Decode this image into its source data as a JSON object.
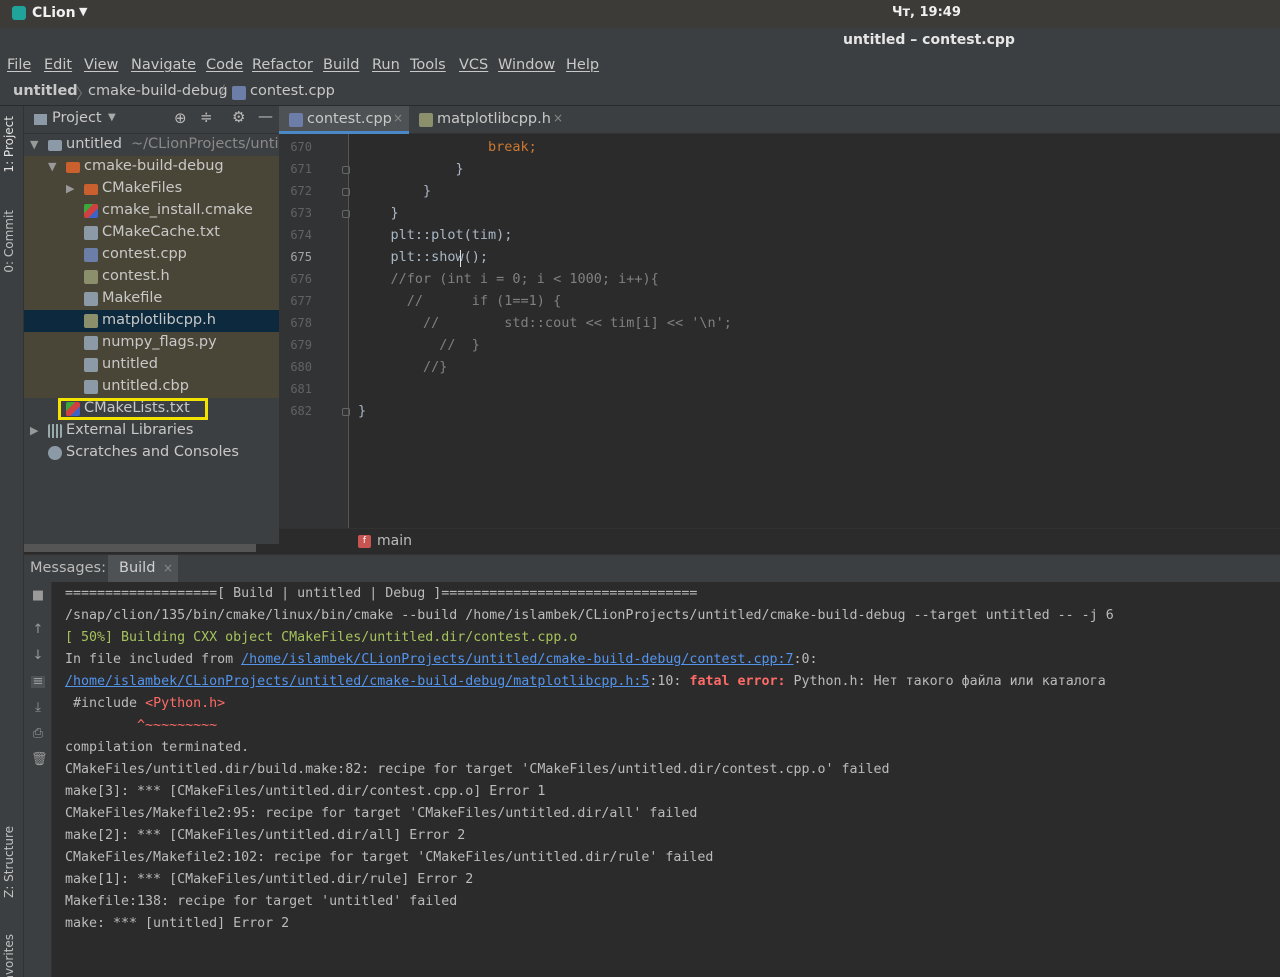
{
  "system": {
    "app_name": "CLion",
    "clock": "Чт, 19:49"
  },
  "window": {
    "title": "untitled – contest.cpp"
  },
  "menu": [
    "File",
    "Edit",
    "View",
    "Navigate",
    "Code",
    "Refactor",
    "Build",
    "Run",
    "Tools",
    "VCS",
    "Window",
    "Help"
  ],
  "breadcrumb": [
    "untitled",
    "cmake-build-debug",
    "contest.cpp"
  ],
  "side_tabs": {
    "project": "1: Project",
    "commit": "0: Commit",
    "structure": "Z: Structure",
    "favorites": "avorites"
  },
  "project": {
    "title": "Project",
    "root_label": "untitled",
    "root_path": "~/CLionProjects/untit",
    "items": [
      {
        "label": "cmake-build-debug",
        "icon": "folder-icon"
      },
      {
        "label": "CMakeFiles",
        "icon": "folder-icon"
      },
      {
        "label": "cmake_install.cmake",
        "icon": "cmake-icon"
      },
      {
        "label": "CMakeCache.txt",
        "icon": "file-icon"
      },
      {
        "label": "contest.cpp",
        "icon": "cpp-icon"
      },
      {
        "label": "contest.h",
        "icon": "h-icon"
      },
      {
        "label": "Makefile",
        "icon": "file-icon"
      },
      {
        "label": "matplotlibcpp.h",
        "icon": "h-icon"
      },
      {
        "label": "numpy_flags.py",
        "icon": "file-icon"
      },
      {
        "label": "untitled",
        "icon": "file-icon"
      },
      {
        "label": "untitled.cbp",
        "icon": "file-icon"
      },
      {
        "label": "CMakeLists.txt",
        "icon": "cmake-icon"
      },
      {
        "label": "External Libraries",
        "icon": "library-icon"
      },
      {
        "label": "Scratches and Consoles",
        "icon": "scratch-icon"
      }
    ]
  },
  "tabs": [
    {
      "label": "contest.cpp",
      "active": true
    },
    {
      "label": "matplotlibcpp.h",
      "active": false
    }
  ],
  "editor": {
    "line_numbers": [
      "670",
      "671",
      "672",
      "673",
      "674",
      "675",
      "676",
      "677",
      "678",
      "679",
      "680",
      "681",
      "682"
    ],
    "lines": [
      "                break;",
      "            }",
      "        }",
      "    }",
      "    plt::plot(tim);",
      "    plt::show();",
      "    //for (int i = 0; i < 1000; i++){",
      "      //      if (1==1) {",
      "        //        std::cout << tim[i] << '\\n';",
      "          //  }",
      "        //}",
      "",
      "}"
    ],
    "function_crumb": "main"
  },
  "messages": {
    "label": "Messages:",
    "tab": "Build"
  },
  "console": [
    "===================[ Build | untitled | Debug ]================================",
    "/snap/clion/135/bin/cmake/linux/bin/cmake --build /home/islambek/CLionProjects/untitled/cmake-build-debug --target untitled -- -j 6",
    "[ 50%] Building CXX object CMakeFiles/untitled.dir/contest.cpp.o",
    "In file included from ",
    "/home/islambek/CLionProjects/untitled/cmake-build-debug/contest.cpp:7",
    ":0:",
    "/home/islambek/CLionProjects/untitled/cmake-build-debug/matplotlibcpp.h:5",
    ":10: ",
    "fatal error:",
    " Python.h: Нет такого файла или каталога",
    " #include ",
    "<Python.h>",
    "         ^~~~~~~~~~",
    "compilation terminated.",
    "CMakeFiles/untitled.dir/build.make:82: recipe for target 'CMakeFiles/untitled.dir/contest.cpp.o' failed",
    "make[3]: *** [CMakeFiles/untitled.dir/contest.cpp.o] Error 1",
    "CMakeFiles/Makefile2:95: recipe for target 'CMakeFiles/untitled.dir/all' failed",
    "make[2]: *** [CMakeFiles/untitled.dir/all] Error 2",
    "CMakeFiles/Makefile2:102: recipe for target 'CMakeFiles/untitled.dir/rule' failed",
    "make[1]: *** [CMakeFiles/untitled.dir/rule] Error 2",
    "Makefile:138: recipe for target 'untitled' failed",
    "make: *** [untitled] Error 2"
  ]
}
